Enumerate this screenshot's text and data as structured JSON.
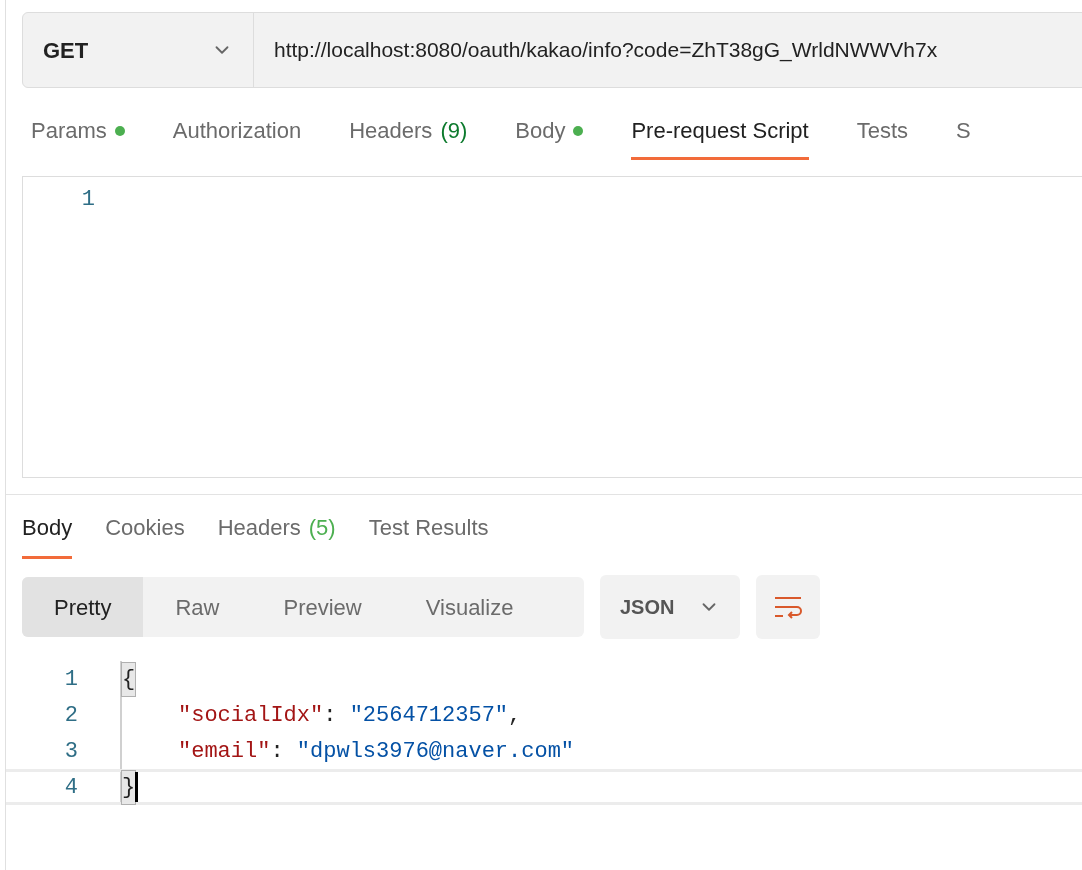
{
  "request": {
    "method": "GET",
    "url": "http://localhost:8080/oauth/kakao/info?code=ZhT38gG_WrldNWWVh7x"
  },
  "request_tabs": [
    {
      "label": "Params",
      "dot": true,
      "selected": false
    },
    {
      "label": "Authorization",
      "dot": false,
      "selected": false
    },
    {
      "label": "Headers",
      "count": "(9)",
      "dot": false,
      "selected": false
    },
    {
      "label": "Body",
      "dot": true,
      "selected": false
    },
    {
      "label": "Pre-request Script",
      "dot": false,
      "selected": true
    },
    {
      "label": "Tests",
      "dot": false,
      "selected": false
    },
    {
      "label": "S",
      "dot": false,
      "selected": false
    }
  ],
  "script_editor": {
    "line_numbers": [
      "1"
    ]
  },
  "response_tabs": [
    {
      "label": "Body",
      "selected": true
    },
    {
      "label": "Cookies",
      "selected": false
    },
    {
      "label": "Headers",
      "count": "(5)",
      "selected": false
    },
    {
      "label": "Test Results",
      "selected": false
    }
  ],
  "view_modes": [
    {
      "label": "Pretty",
      "selected": true
    },
    {
      "label": "Raw",
      "selected": false
    },
    {
      "label": "Preview",
      "selected": false
    },
    {
      "label": "Visualize",
      "selected": false
    }
  ],
  "format": "JSON",
  "code_lines": [
    {
      "number": "1",
      "current": false,
      "tokens": [
        {
          "kind": "brace",
          "text": "{"
        }
      ]
    },
    {
      "number": "2",
      "current": false,
      "tokens": [
        {
          "kind": "key",
          "text": "\"socialIdx\""
        },
        {
          "kind": "punct",
          "text": ": "
        },
        {
          "kind": "string",
          "text": "\"2564712357\""
        },
        {
          "kind": "punct",
          "text": ","
        }
      ]
    },
    {
      "number": "3",
      "current": false,
      "tokens": [
        {
          "kind": "key",
          "text": "\"email\""
        },
        {
          "kind": "punct",
          "text": ": "
        },
        {
          "kind": "string",
          "text": "\"dpwls3976@naver.com\""
        }
      ]
    },
    {
      "number": "4",
      "current": true,
      "tokens": [
        {
          "kind": "brace",
          "text": "}"
        }
      ]
    }
  ]
}
